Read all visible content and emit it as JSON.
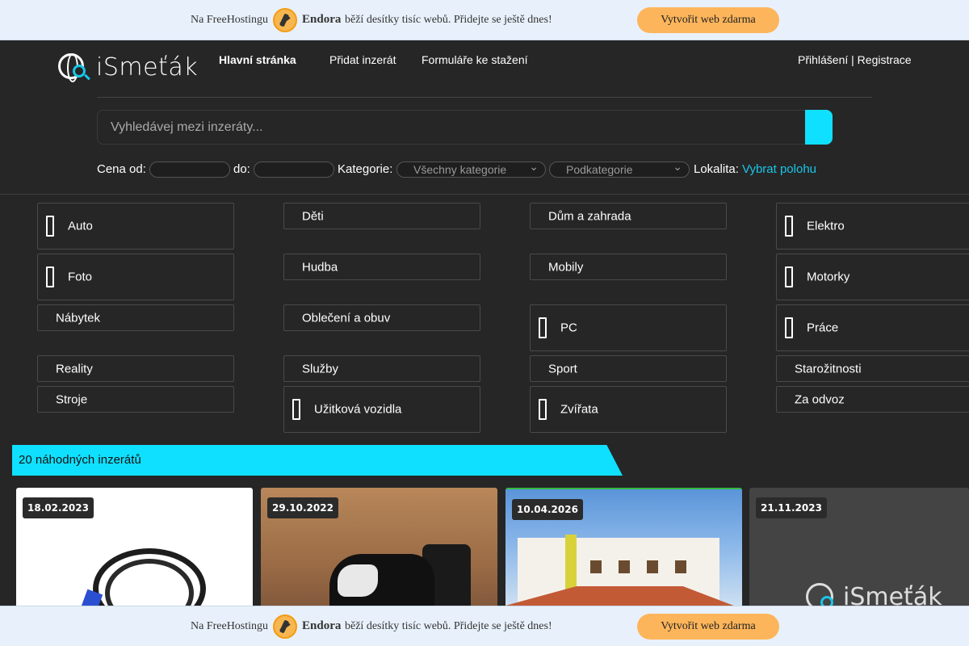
{
  "promo": {
    "prefix": "Na FreeHostingu",
    "brand": "Endora",
    "suffix": "běží desítky tisíc webů. Přidejte se ještě dnes!",
    "cta": "Vytvořit web zdarma"
  },
  "header": {
    "logo_text": "iSmeťák",
    "nav": {
      "home": " Hlavní stránka",
      "add": "Přidat inzerát",
      "forms": "Formuláře ke stažení",
      "auth": "Přihlášení | Registrace"
    }
  },
  "search": {
    "placeholder": "Vyhledávej mezi inzeráty...",
    "button_icon": ""
  },
  "filters": {
    "price_from_label": "Cena od:",
    "price_to_label": "do:",
    "category_label": "Kategorie:",
    "category_value": "Všechny kategorie",
    "subcategory_value": "Podkategorie",
    "location_label": "Lokalita:",
    "location_link": "Vybrat polohu"
  },
  "categories": [
    {
      "label": "Auto"
    },
    {
      "label": "Děti"
    },
    {
      "label": "Dům a zahrada"
    },
    {
      "label": "Elektro"
    },
    {
      "label": "Foto"
    },
    {
      "label": "Hudba"
    },
    {
      "label": "Mobily"
    },
    {
      "label": "Motorky"
    },
    {
      "label": "Nábytek"
    },
    {
      "label": "Oblečení a obuv"
    },
    {
      "label": "PC"
    },
    {
      "label": "Práce"
    },
    {
      "label": "Reality"
    },
    {
      "label": "Služby"
    },
    {
      "label": "Sport"
    },
    {
      "label": "Starožitnosti"
    },
    {
      "label": "Stroje"
    },
    {
      "label": "Užitková vozidla"
    },
    {
      "label": "Zvířata"
    },
    {
      "label": "Za odvoz"
    }
  ],
  "random": {
    "title": "20 náhodných inzerátů",
    "cards": [
      {
        "date": "18.02.2023"
      },
      {
        "date": "29.10.2022"
      },
      {
        "date": "10.04.2026"
      },
      {
        "date": "21.11.2023",
        "placeholder_logo": "iSmeťák"
      }
    ]
  },
  "colors": {
    "accent": "#0fe0ff",
    "background": "#262626",
    "promo_bg": "#e8f1fb",
    "promo_cta": "#fdb55b",
    "link": "#18c6e8"
  }
}
